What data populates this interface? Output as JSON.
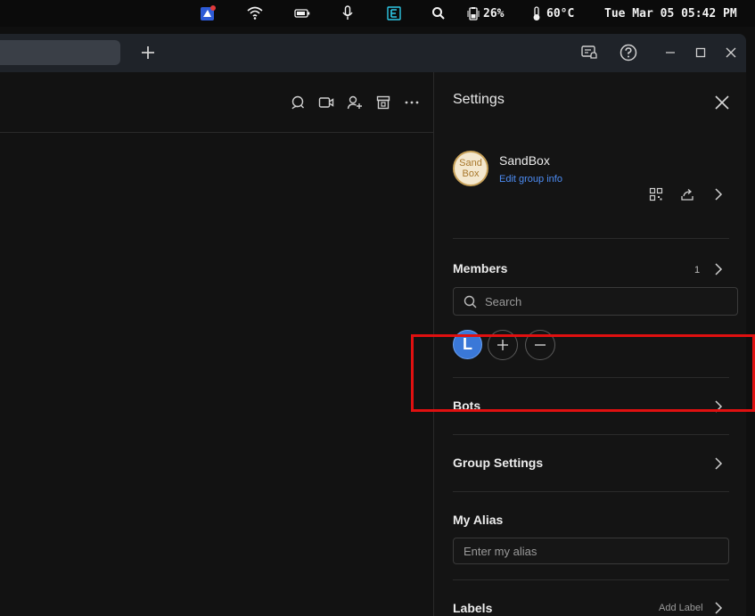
{
  "system_bar": {
    "battery_percent": "26%",
    "temperature": "60°C",
    "datetime": "Tue Mar 05 05:42 PM",
    "icons": [
      "app-icon",
      "wifi-icon",
      "battery-icon",
      "microphone-icon",
      "e-badge-icon",
      "search-icon",
      "battery-status-icon",
      "thermometer-icon"
    ]
  },
  "window": {
    "icons": [
      "new-tab-plus-icon",
      "notification-settings-icon",
      "help-icon",
      "minimize-icon",
      "maximize-icon",
      "close-icon"
    ]
  },
  "chat_header": {
    "icons": [
      "search-chat-icon",
      "video-call-icon",
      "add-member-icon",
      "archive-icon",
      "more-icon"
    ]
  },
  "settings": {
    "title": "Settings",
    "group": {
      "avatar_line1": "Sand",
      "avatar_line2": "Box",
      "name": "SandBox",
      "edit_link": "Edit group info"
    },
    "members": {
      "label": "Members",
      "count": "1",
      "search_placeholder": "Search",
      "member_initial": "L"
    },
    "bots": {
      "label": "Bots"
    },
    "group_settings": {
      "label": "Group Settings"
    },
    "my_alias": {
      "label": "My Alias",
      "placeholder": "Enter my alias"
    },
    "labels": {
      "label": "Labels",
      "add_label": "Add Label"
    }
  },
  "colors": {
    "accent_link": "#4d8df5",
    "highlight_box": "#e01010",
    "panel_bg": "#141414"
  }
}
